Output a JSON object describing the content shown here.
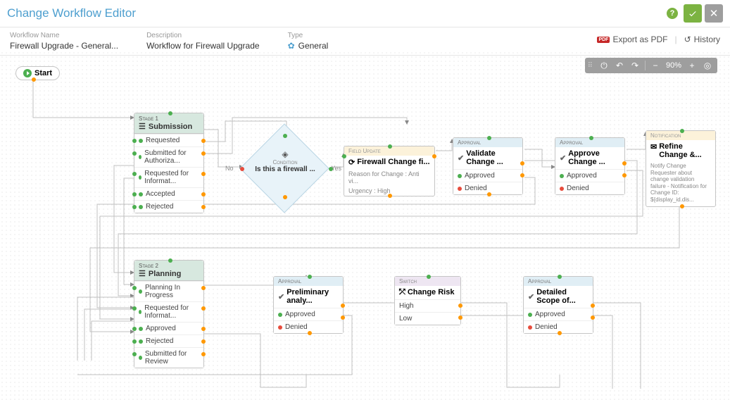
{
  "header": {
    "title": "Change Workflow Editor"
  },
  "meta": {
    "workflow_name_label": "Workflow Name",
    "workflow_name": "Firewall Upgrade - General...",
    "description_label": "Description",
    "description": "Workflow for Firewall Upgrade",
    "type_label": "Type",
    "type_value": "General",
    "export_pdf": "Export as PDF",
    "history": "History"
  },
  "toolbar": {
    "zoom": "90%"
  },
  "start": {
    "label": "Start"
  },
  "stage1": {
    "label": "Stage 1",
    "title": "Submission",
    "items": [
      "Requested",
      "Submitted for Authoriza...",
      "Requested for Informat...",
      "Accepted",
      "Rejected"
    ]
  },
  "condition1": {
    "label": "Condition",
    "title": "Is this a firewall ...",
    "no": "No",
    "yes": "Yes"
  },
  "fieldupd": {
    "label": "Field Update",
    "title": "Firewall Change fi...",
    "line1": "Reason for Change : Anti vi...",
    "line2": "Urgency : High"
  },
  "approval_validate": {
    "label": "Approval",
    "title": "Validate Change ...",
    "approved": "Approved",
    "denied": "Denied"
  },
  "approval_approve": {
    "label": "Approval",
    "title": "Approve Change ...",
    "approved": "Approved",
    "denied": "Denied"
  },
  "notification": {
    "label": "Notification",
    "title": "Refine Change &...",
    "body": "Notify Change Requester about change validation failure - Notification for Change ID: ${display_id.dis..."
  },
  "stage2": {
    "label": "Stage 2",
    "title": "Planning",
    "items": [
      "Planning In Progress",
      "Requested for Informat...",
      "Approved",
      "Rejected",
      "Submitted for Review"
    ]
  },
  "approval_prelim": {
    "label": "Approval",
    "title": "Preliminary analy...",
    "approved": "Approved",
    "denied": "Denied"
  },
  "switch": {
    "label": "Switch",
    "title": "Change Risk",
    "items": [
      "High",
      "Low"
    ]
  },
  "approval_scope": {
    "label": "Approval",
    "title": "Detailed Scope of...",
    "approved": "Approved",
    "denied": "Denied"
  }
}
